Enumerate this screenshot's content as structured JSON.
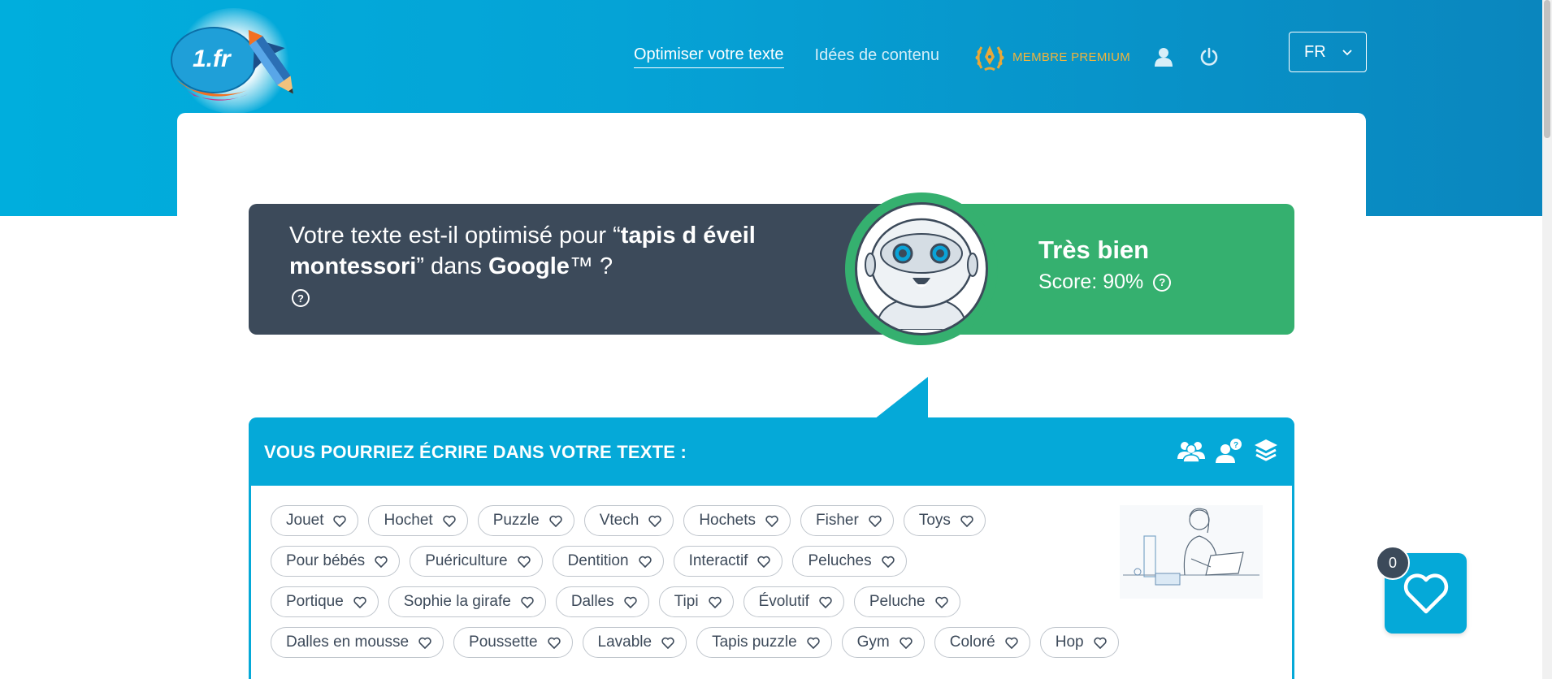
{
  "header": {
    "logo_text": "1.fr",
    "nav": [
      {
        "label": "Optimiser votre texte",
        "active": true
      },
      {
        "label": "Idées de contenu",
        "active": false
      }
    ],
    "premium_label": "MEMBRE PREMIUM",
    "language": "FR",
    "icons": [
      "user-icon",
      "power-icon"
    ]
  },
  "banner": {
    "question_prefix": "Votre texte est-il optimisé pour “",
    "keyword": "tapis d éveil montessori",
    "question_middle": "” dans ",
    "engine": "Google",
    "question_suffix": "™ ?",
    "help": "?",
    "score_title": "Très bien",
    "score_text": "Score: 90%",
    "score_value": 90,
    "colors": {
      "dark": "#3c4a5a",
      "green": "#35b06f",
      "accent": "#05a9d8"
    }
  },
  "suggestions": {
    "title": "VOUS POURRIEZ ÉCRIRE DANS VOTRE TEXTE :",
    "icons": [
      "group-icon",
      "user-question-icon",
      "layers-icon"
    ],
    "rows": [
      [
        "Jouet",
        "Hochet",
        "Puzzle",
        "Vtech",
        "Hochets",
        "Fisher",
        "Toys"
      ],
      [
        "Pour bébés",
        "Puériculture",
        "Dentition",
        "Interactif",
        "Peluches"
      ],
      [
        "Portique",
        "Sophie la girafe",
        "Dalles",
        "Tipi",
        "Évolutif",
        "Peluche"
      ],
      [
        "Dalles en mousse",
        "Poussette",
        "Lavable",
        "Tapis puzzle",
        "Gym",
        "Coloré",
        "Hop"
      ]
    ]
  },
  "favorites": {
    "count": "0"
  }
}
